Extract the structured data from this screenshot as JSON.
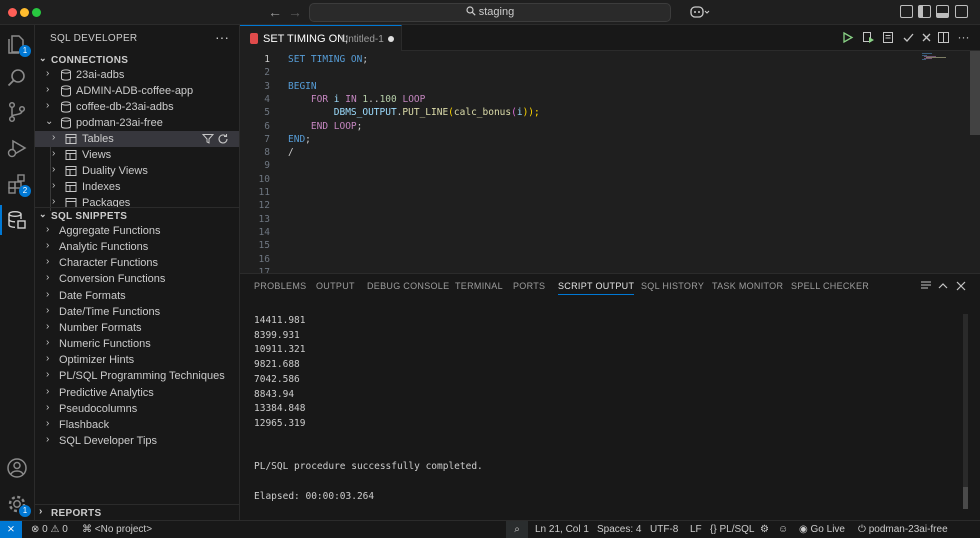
{
  "titlebar": {
    "search_text": "staging",
    "back": "←",
    "forward": "→"
  },
  "activity": {
    "explorer_badge": "1",
    "extensions_badge": "2",
    "accounts_badge": "1"
  },
  "sidebar": {
    "title": "SQL DEVELOPER",
    "more": "···",
    "connections_header": "CONNECTIONS",
    "connections": [
      {
        "label": "23ai-adbs"
      },
      {
        "label": "ADMIN-ADB-coffee-app"
      },
      {
        "label": "coffee-db-23ai-adbs"
      },
      {
        "label": "podman-23ai-free"
      }
    ],
    "schema_items": [
      {
        "label": "Tables"
      },
      {
        "label": "Views"
      },
      {
        "label": "Duality Views"
      },
      {
        "label": "Indexes"
      },
      {
        "label": "Packages"
      }
    ],
    "snippets_header": "SQL SNIPPETS",
    "snippets": [
      "Aggregate Functions",
      "Analytic Functions",
      "Character Functions",
      "Conversion Functions",
      "Date Formats",
      "Date/Time Functions",
      "Number Formats",
      "Numeric Functions",
      "Optimizer Hints",
      "PL/SQL Programming Techniques",
      "Predictive Analytics",
      "Pseudocolumns",
      "Flashback",
      "SQL Developer Tips"
    ],
    "reports_header": "REPORTS"
  },
  "editor": {
    "tab_name": "SET TIMING ON;",
    "tab_desc": "Untitled-1",
    "line_numbers": [
      "1",
      "2",
      "3",
      "4",
      "5",
      "6",
      "7",
      "8",
      "9",
      "10",
      "11",
      "12",
      "13",
      "14",
      "15",
      "16",
      "17"
    ],
    "code": {
      "l1_a": "SET TIMING ",
      "l1_b": "ON",
      "l1_c": ";",
      "l3": "BEGIN",
      "l4_a": "    FOR ",
      "l4_b": "i",
      "l4_c": " IN ",
      "l4_d": "1",
      "l4_e": "..",
      "l4_f": "100",
      "l4_g": " LOOP",
      "l5_a": "        DBMS_OUTPUT",
      "l5_b": ".",
      "l5_c": "PUT_LINE",
      "l5_d": "(",
      "l5_e": "calc_bonus",
      "l5_f": "(",
      "l5_g": "i",
      "l5_h": "));",
      "l6_a": "    END LOOP",
      "l6_b": ";",
      "l7_a": "END",
      "l7_b": ";",
      "l8": "/"
    }
  },
  "panel": {
    "tabs": [
      "PROBLEMS",
      "OUTPUT",
      "DEBUG CONSOLE",
      "TERMINAL",
      "PORTS",
      "SCRIPT OUTPUT",
      "SQL HISTORY",
      "TASK MONITOR",
      "SPELL CHECKER"
    ],
    "output_lines": [
      "14411.981",
      "8399.931",
      "10911.321",
      "9821.688",
      "7042.586",
      "8843.94",
      "13384.848",
      "12965.319"
    ],
    "completion_msg": "PL/SQL procedure successfully completed.",
    "elapsed": "Elapsed: 00:00:03.264"
  },
  "status": {
    "errors": "0",
    "warnings": "0",
    "project": "<No project>",
    "position": "Ln 21, Col 1",
    "spaces": "Spaces: 4",
    "encoding": "UTF-8",
    "eol": "LF",
    "language": "PL/SQL",
    "golive": "Go Live",
    "connection": "podman-23ai-free"
  },
  "colors": {
    "accent": "#0078d4",
    "editor_bg": "#1f1f1f",
    "panel_bg": "#181818"
  }
}
